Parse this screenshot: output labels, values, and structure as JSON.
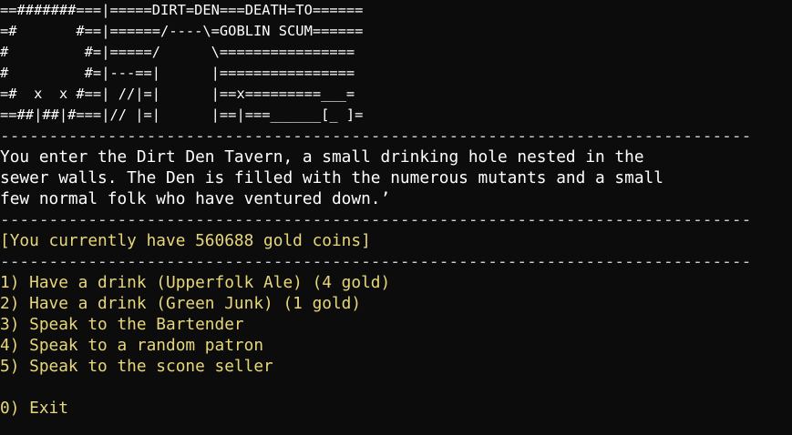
{
  "colors": {
    "background": "#0c0c0c",
    "text_default": "#cccccc",
    "text_highlight": "#e8d77a",
    "text_bright": "#ffffff"
  },
  "banner": {
    "lines": [
      "==#######===|=====DIRT=DEN===DEATH=TO======",
      "=#       #==|======/----\\=GOBLIN SCUM======",
      "#         #=|=====/      \\================",
      "#         #=|---==|      |================",
      "=#  x  x #==| //|=|      |==x=========___=",
      "==##|##|#===|// |=|      |==|===______[_ ]="
    ]
  },
  "separator": "-----------------------------------------------------------------------------",
  "description": {
    "lines": [
      "You enter the Dirt Den Tavern, a small drinking hole nested in the",
      "sewer walls. The Den is filled with the numerous mutants and a small",
      "few normal folk who have ventured down.’"
    ]
  },
  "gold_status": "[You currently have 560688 gold coins]",
  "menu": {
    "options": [
      "1) Have a drink (Upperfolk Ale) (4 gold)",
      "2) Have a drink (Green Junk) (1 gold)",
      "3) Speak to the Bartender",
      "4) Speak to a random patron",
      "5) Speak to the scone seller"
    ],
    "exit": "0) Exit"
  }
}
